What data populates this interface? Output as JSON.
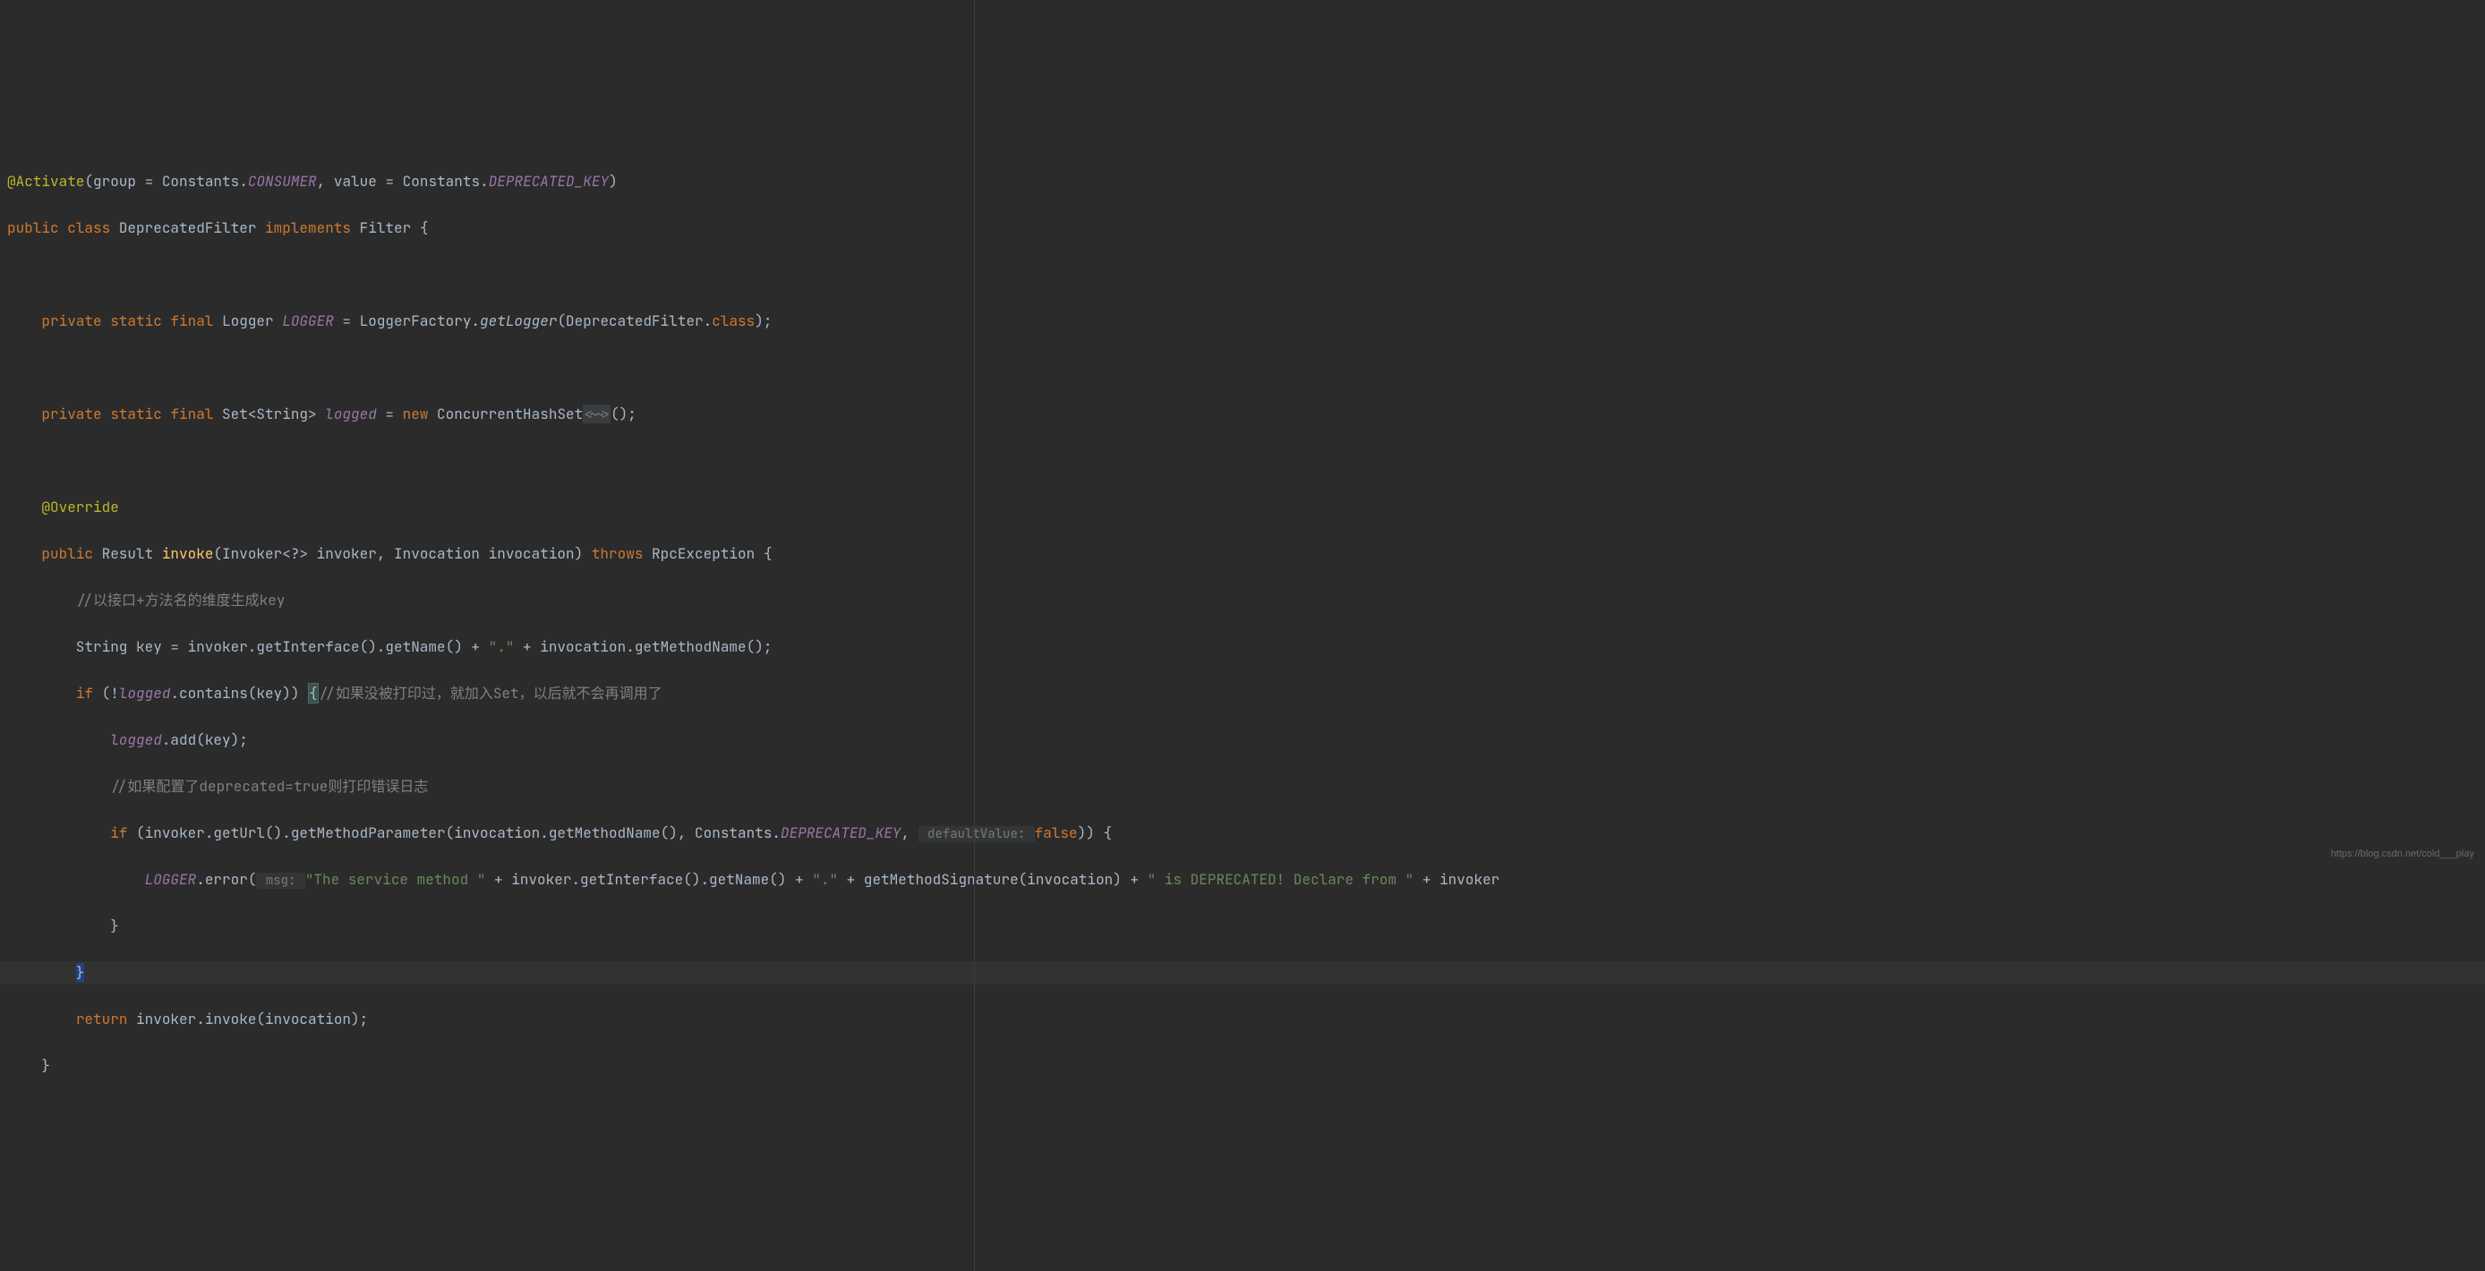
{
  "watermark": "https://blog.csdn.net/cold___play",
  "colors": {
    "background": "#2b2b2b",
    "keyword": "#cc7832",
    "annotation": "#bbb529",
    "string": "#6a8759",
    "comment": "#808080",
    "field": "#9876aa",
    "text": "#a9b7c6"
  },
  "code": {
    "line1": {
      "annotation": "@Activate",
      "group_param": "group",
      "eq1": " = Constants.",
      "consumer": "CONSUMER",
      "comma": ", ",
      "value_param": "value",
      "eq2": " = Constants.",
      "deprecated_key": "DEPRECATED_KEY",
      "close": ")"
    },
    "line2": {
      "public": "public ",
      "class": "class ",
      "name": "DeprecatedFilter ",
      "implements": "implements ",
      "filter": "Filter ",
      "brace": "{"
    },
    "line4": {
      "private": "    private ",
      "static": "static ",
      "final": "final ",
      "type": "Logger ",
      "name": "LOGGER",
      "eq": " = LoggerFactory.",
      "method": "getLogger",
      "args": "(DeprecatedFilter.",
      "class_kw": "class",
      "close": ");"
    },
    "line6": {
      "private": "    private ",
      "static": "static ",
      "final": "final ",
      "type": "Set<String> ",
      "name": "logged",
      "eq": " = ",
      "new": "new ",
      "ctor": "ConcurrentHashSet",
      "diamond": "<~>",
      "close": "();"
    },
    "line8": {
      "indent": "    ",
      "override": "@Override"
    },
    "line9": {
      "public": "    public ",
      "ret": "Result ",
      "name": "invoke",
      "sig": "(Invoker<?> invoker, Invocation invocation) ",
      "throws": "throws ",
      "exc": "RpcException ",
      "brace": "{"
    },
    "line10": {
      "indent": "        ",
      "comment": "//以接口+方法名的维度生成key"
    },
    "line11": {
      "text1": "        String key = invoker.getInterface().getName() + ",
      "str1": "\".\"",
      "text2": " + invocation.getMethodName();"
    },
    "line12": {
      "indent": "        ",
      "if": "if ",
      "cond1": "(!",
      "logged": "logged",
      "cond2": ".contains(key)) ",
      "brace": "{",
      "comment": "//如果没被打印过，就加入Set，以后就不会再调用了"
    },
    "line13": {
      "indent": "            ",
      "logged": "logged",
      "rest": ".add(key);"
    },
    "line14": {
      "indent": "            ",
      "comment": "//如果配置了deprecated=true则打印错误日志"
    },
    "line15": {
      "indent": "            ",
      "if": "if ",
      "open": "(invoker.getUrl().getMethodParameter(invocation.getMethodName(), Constants.",
      "depkey": "DEPRECATED_KEY",
      "comma": ", ",
      "hint": " defaultValue: ",
      "false": "false",
      "close": ")) {"
    },
    "line16": {
      "indent": "                ",
      "logger": "LOGGER",
      "err": ".error(",
      "hint": " msg: ",
      "str1": "\"The service method \"",
      "p1": " + invoker.getInterface().getName() + ",
      "str2": "\".\"",
      "p2": " + getMethodSignature(invocation) + ",
      "str3": "\" is DEPRECATED! Declare from \"",
      "p3": " + invoker"
    },
    "line17": {
      "indent": "            ",
      "brace": "}"
    },
    "line18": {
      "indent": "        ",
      "brace": "}"
    },
    "line19": {
      "indent": "        ",
      "return": "return ",
      "rest": "invoker.invoke(invocation);"
    },
    "line20": {
      "indent": "    ",
      "brace": "}"
    }
  }
}
